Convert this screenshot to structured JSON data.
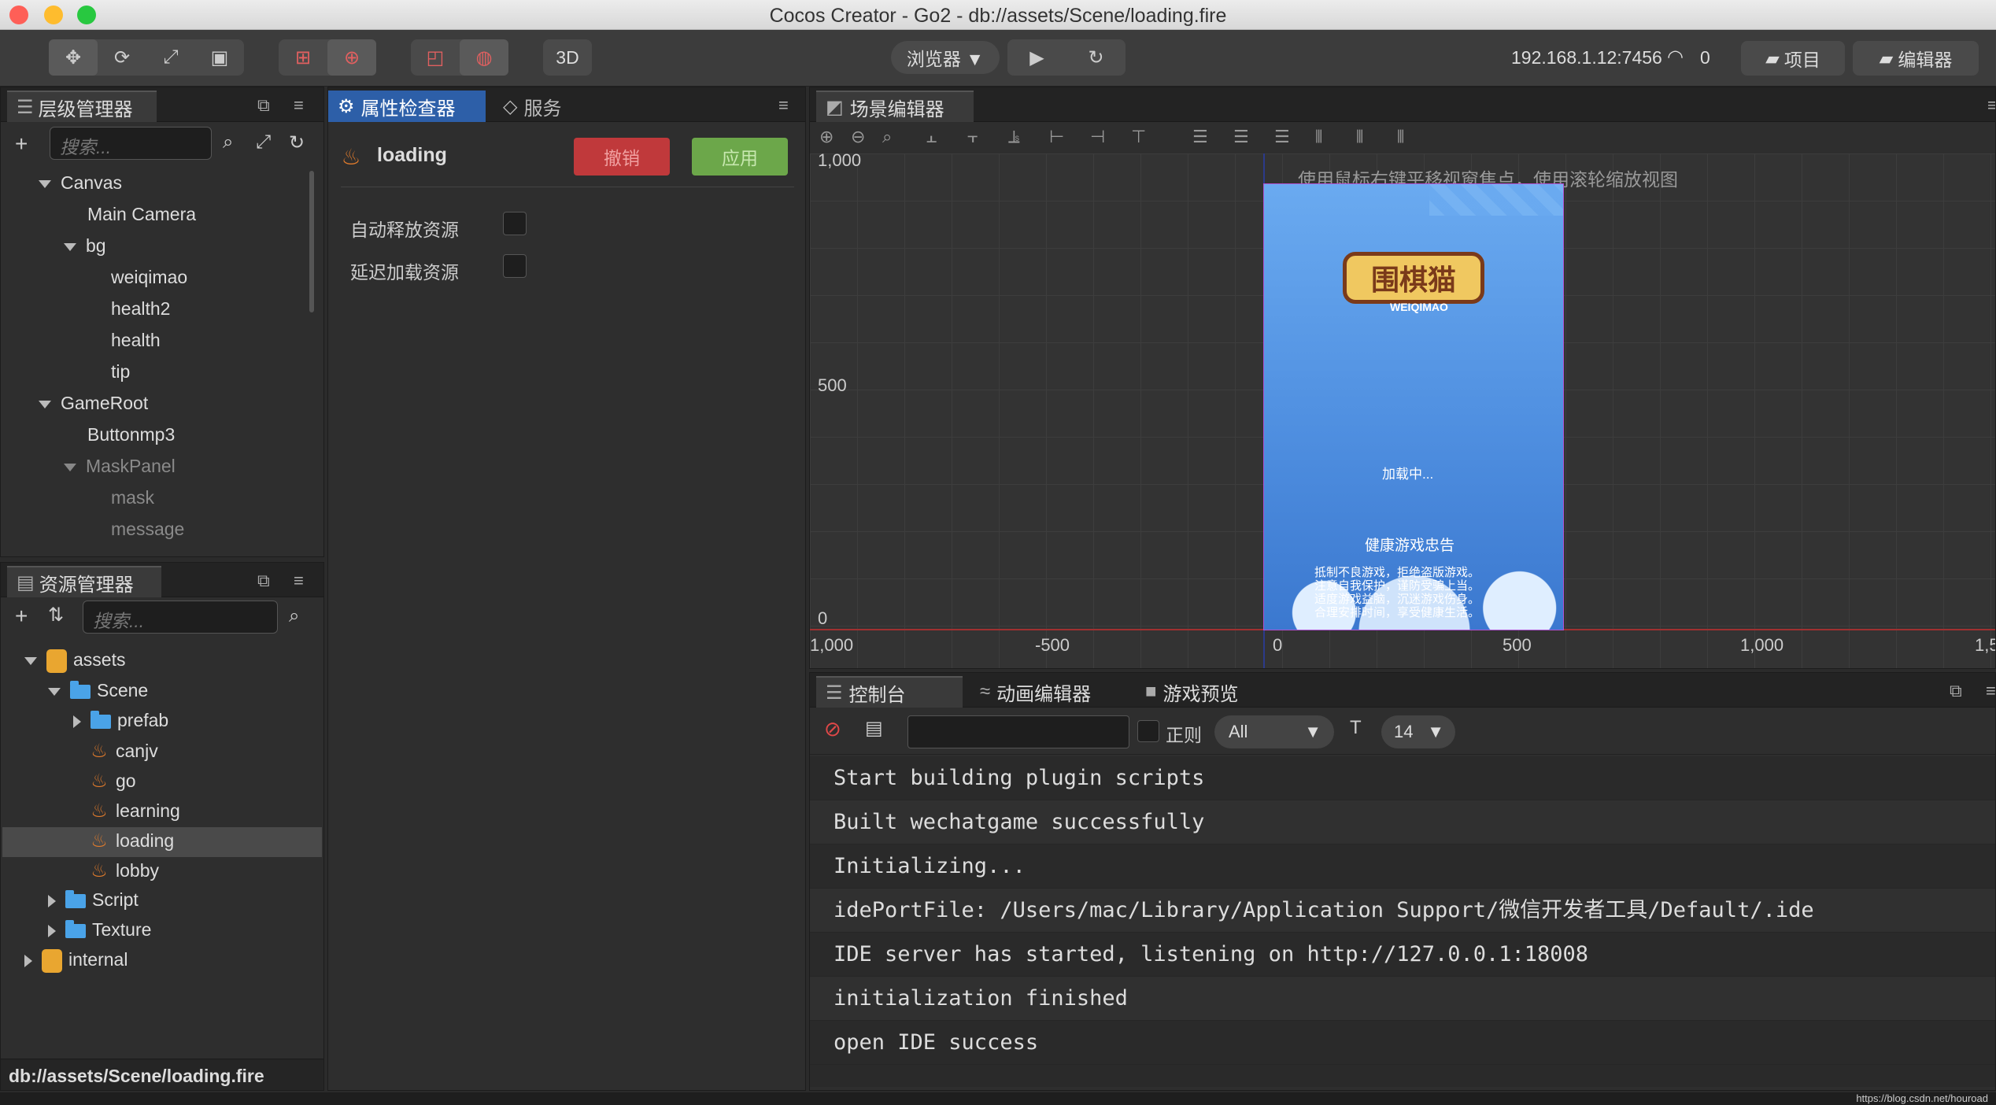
{
  "window": {
    "title": "Cocos Creator - Go2 - db://assets/Scene/loading.fire"
  },
  "toolbar": {
    "btn_3d": "3D",
    "browser_label": "浏览器 ▼",
    "ip_address": "192.168.1.12:7456",
    "device_count": "0",
    "project_button": "项目",
    "editor_button": "编辑器"
  },
  "hierarchy": {
    "tab_label": "层级管理器",
    "search_placeholder": "搜索...",
    "nodes": [
      {
        "label": "Canvas"
      },
      {
        "label": "Main Camera"
      },
      {
        "label": "bg"
      },
      {
        "label": "weiqimao"
      },
      {
        "label": "health2"
      },
      {
        "label": "health"
      },
      {
        "label": "tip"
      },
      {
        "label": "GameRoot"
      },
      {
        "label": "Buttonmp3"
      },
      {
        "label": "MaskPanel"
      },
      {
        "label": "mask"
      },
      {
        "label": "message"
      }
    ]
  },
  "assets": {
    "tab_label": "资源管理器",
    "search_placeholder": "搜索...",
    "items": [
      {
        "label": "assets"
      },
      {
        "label": "Scene"
      },
      {
        "label": "prefab"
      },
      {
        "label": "canjv"
      },
      {
        "label": "go"
      },
      {
        "label": "learning"
      },
      {
        "label": "loading"
      },
      {
        "label": "lobby"
      },
      {
        "label": "Script"
      },
      {
        "label": "Texture"
      },
      {
        "label": "internal"
      }
    ],
    "status_path": "db://assets/Scene/loading.fire"
  },
  "inspector": {
    "tab_label": "属性检查器",
    "services_tab": "服务",
    "asset_name": "loading",
    "revert_button": "撤销",
    "apply_button": "应用",
    "auto_release_label": "自动释放资源",
    "async_load_label": "延迟加载资源"
  },
  "scene": {
    "tab_label": "场景编辑器",
    "hint": "使用鼠标右键平移视窗焦点，使用滚轮缩放视图",
    "y_ticks": [
      "1,000",
      "500",
      "0"
    ],
    "x_ticks": [
      "1,000",
      "-500",
      "0",
      "500",
      "1,000",
      "1,5"
    ],
    "game": {
      "logo_text": "围棋猫",
      "logo_sub": "WEIQIMAO",
      "loading_text": "加载中...",
      "health_title": "健康游戏忠告",
      "health_lines": [
        "抵制不良游戏，拒绝盗版游戏。",
        "注意自我保护，谨防受骗上当。",
        "适度游戏益脑，沉迷游戏伤身。",
        "合理安排时间，享受健康生活。"
      ]
    }
  },
  "console": {
    "tab_label": "控制台",
    "animation_tab": "动画编辑器",
    "preview_tab": "游戏预览",
    "regex_label": "正则",
    "level_select": "All",
    "font_size_select": "14",
    "lines": [
      "Start building plugin scripts",
      "Built wechatgame successfully",
      "Initializing...",
      "idePortFile: /Users/mac/Library/Application Support/微信开发者工具/Default/.ide",
      "IDE server has started, listening on http://127.0.0.1:18008",
      "initialization finished",
      "open IDE success"
    ]
  },
  "footer": {
    "watermark": "https://blog.csdn.net/houroad"
  },
  "colors": {
    "accent_blue": "#2d5fa8",
    "revert_red": "#c0393b",
    "apply_green": "#6ca74a",
    "game_blue": "#4f8fe0"
  }
}
